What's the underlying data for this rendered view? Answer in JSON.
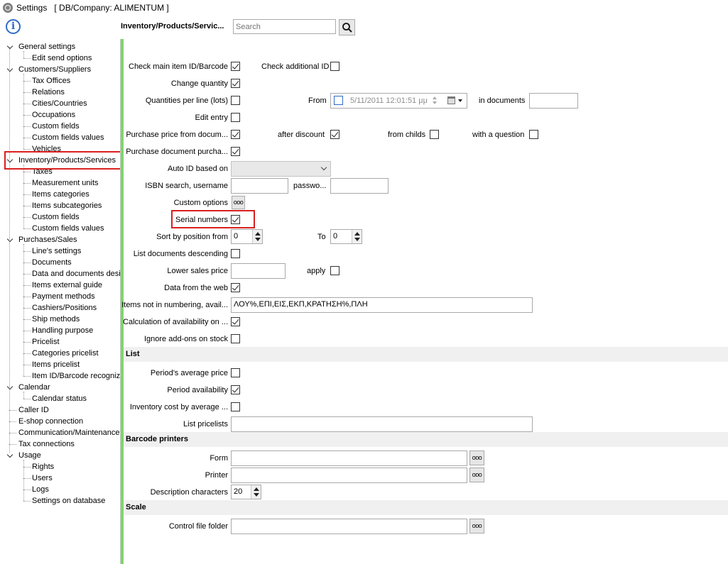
{
  "window": {
    "title": "Settings",
    "db_company": "[ DB/Company: ALIMENTUM ]"
  },
  "tree": [
    {
      "label": "General settings",
      "level": 0,
      "expanded": true
    },
    {
      "label": "Edit send options",
      "level": 1
    },
    {
      "label": "Customers/Suppliers",
      "level": 0,
      "expanded": true
    },
    {
      "label": "Tax Offices",
      "level": 1
    },
    {
      "label": "Relations",
      "level": 1
    },
    {
      "label": "Cities/Countries",
      "level": 1
    },
    {
      "label": "Occupations",
      "level": 1
    },
    {
      "label": "Custom fields",
      "level": 1
    },
    {
      "label": "Custom fields values",
      "level": 1
    },
    {
      "label": "Vehicles",
      "level": 1
    },
    {
      "label": "Inventory/Products/Services",
      "level": 0,
      "expanded": true,
      "selected": true
    },
    {
      "label": "Taxes",
      "level": 1
    },
    {
      "label": "Measurement units",
      "level": 1
    },
    {
      "label": "Items categories",
      "level": 1
    },
    {
      "label": "Items subcategories",
      "level": 1
    },
    {
      "label": "Custom fields",
      "level": 1
    },
    {
      "label": "Custom fields values",
      "level": 1
    },
    {
      "label": "Purchases/Sales",
      "level": 0,
      "expanded": true
    },
    {
      "label": "Line's settings",
      "level": 1
    },
    {
      "label": "Documents",
      "level": 1
    },
    {
      "label": "Data and documents desi",
      "level": 1
    },
    {
      "label": "Items external guide",
      "level": 1
    },
    {
      "label": "Payment methods",
      "level": 1
    },
    {
      "label": "Cashiers/Positions",
      "level": 1
    },
    {
      "label": "Ship methods",
      "level": 1
    },
    {
      "label": "Handling purpose",
      "level": 1
    },
    {
      "label": "Pricelist",
      "level": 1
    },
    {
      "label": "Categories pricelist",
      "level": 1
    },
    {
      "label": "Items pricelist",
      "level": 1
    },
    {
      "label": "Item ID/Barcode recognize",
      "level": 1
    },
    {
      "label": "Calendar",
      "level": 0,
      "expanded": true
    },
    {
      "label": "Calendar status",
      "level": 1
    },
    {
      "label": "Caller ID",
      "level": 0
    },
    {
      "label": "E-shop connection",
      "level": 0
    },
    {
      "label": "Communication/Maintenance",
      "level": 0
    },
    {
      "label": "Tax connections",
      "level": 0
    },
    {
      "label": "Usage",
      "level": 0,
      "expanded": true
    },
    {
      "label": "Rights",
      "level": 1
    },
    {
      "label": "Users",
      "level": 1
    },
    {
      "label": "Logs",
      "level": 1
    },
    {
      "label": "Settings on database",
      "level": 1
    }
  ],
  "header": {
    "title": "Inventory/Products/Servic...",
    "search_placeholder": "Search",
    "search_icon": "magnifier-icon"
  },
  "form": {
    "check_main_id": {
      "label": "Check main item ID/Barcode",
      "checked": true
    },
    "check_additional_id": {
      "label": "Check additional ID",
      "checked": false
    },
    "change_quantity": {
      "label": "Change quantity",
      "checked": true
    },
    "quantities_per_line": {
      "label": "Quantities per line (lots)",
      "checked": false
    },
    "from_label": "From",
    "from_date": "5/11/2011 12:01:51 μμ",
    "in_documents_label": "in documents",
    "in_documents_value": "",
    "edit_entry": {
      "label": "Edit entry",
      "checked": false
    },
    "purchase_price_from_docs": {
      "label": "Purchase price from docum...",
      "checked": true
    },
    "after_discount": {
      "label": "after discount",
      "checked": true
    },
    "from_childs": {
      "label": "from childs",
      "checked": false
    },
    "with_a_question": {
      "label": "with a question",
      "checked": false
    },
    "purchase_doc_purchase": {
      "label": "Purchase document purcha...",
      "checked": true
    },
    "auto_id_label": "Auto ID based on",
    "auto_id_value": "",
    "isbn_label": "ISBN search, username",
    "isbn_username": "",
    "password_label": "passwo...",
    "password_value": "",
    "custom_options_label": "Custom options",
    "ellipsis": "ooo",
    "serial_numbers": {
      "label": "Serial numbers",
      "checked": true
    },
    "sort_by_position_label": "Sort by position from",
    "sort_from": "0",
    "to_label": "To",
    "sort_to": "0",
    "list_docs_desc": {
      "label": "List documents descending",
      "checked": false
    },
    "lower_sales_price_label": "Lower sales price",
    "lower_sales_price": "",
    "apply": {
      "label": "apply",
      "checked": false
    },
    "data_from_web": {
      "label": "Data from the web",
      "checked": true
    },
    "items_not_in_numbering_label": "Items not in numbering, avail...",
    "items_not_in_numbering": "ΛΟΥ%,ΕΠΙ,ΕΙΣ,ΕΚΠ,ΚΡΑΤΗΣΗ%,ΠΛΗ",
    "calc_availability": {
      "label": "Calculation of availability on ...",
      "checked": true
    },
    "ignore_addons": {
      "label": "Ignore add-ons on stock",
      "checked": false
    }
  },
  "list_section": {
    "title": "List",
    "periods_avg_price": {
      "label": "Period's average price",
      "checked": false
    },
    "period_availability": {
      "label": "Period availability",
      "checked": true
    },
    "inventory_cost": {
      "label": "Inventory cost by average ...",
      "checked": false
    },
    "list_pricelists_label": "List pricelists",
    "list_pricelists": ""
  },
  "barcode_section": {
    "title": "Barcode printers",
    "form_label": "Form",
    "form_value": "",
    "printer_label": "Printer",
    "printer_value": "",
    "desc_chars_label": "Description characters",
    "desc_chars": "20"
  },
  "scale_section": {
    "title": "Scale",
    "control_file_label": "Control file folder",
    "control_file": ""
  },
  "colors": {
    "highlight_red": "#d9201f",
    "accent_green": "#7ed66a",
    "info_blue": "#2f6bc7"
  }
}
